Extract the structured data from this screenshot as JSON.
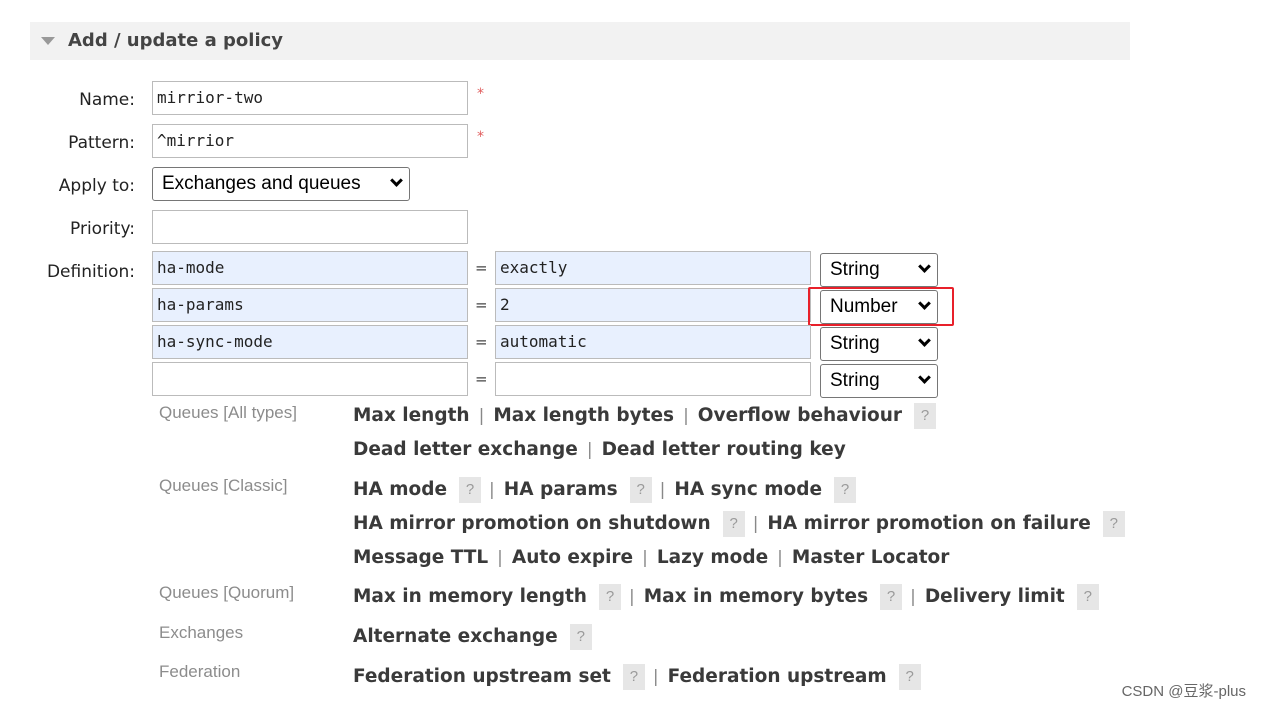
{
  "section": {
    "title": "Add / update a policy"
  },
  "form": {
    "name_label": "Name:",
    "name_value": "mirrior-two",
    "pattern_label": "Pattern:",
    "pattern_value": "^mirrior",
    "required_mark": "*",
    "apply_to_label": "Apply to:",
    "apply_to_value": "Exchanges and queues",
    "priority_label": "Priority:",
    "priority_value": "",
    "definition_label": "Definition:"
  },
  "definitions": [
    {
      "key": "ha-mode",
      "eq": "=",
      "value": "exactly",
      "type": "String"
    },
    {
      "key": "ha-params",
      "eq": "=",
      "value": "2",
      "type": "Number"
    },
    {
      "key": "ha-sync-mode",
      "eq": "=",
      "value": "automatic",
      "type": "String"
    },
    {
      "key": "",
      "eq": "=",
      "value": "",
      "type": "String"
    }
  ],
  "help_mark": "?",
  "separator": "|",
  "categories": {
    "queues_all": "Queues [All types]",
    "queues_classic": "Queues [Classic]",
    "queues_quorum": "Queues [Quorum]",
    "exchanges": "Exchanges",
    "federation": "Federation"
  },
  "links": {
    "max_length": "Max length",
    "max_length_bytes": "Max length bytes",
    "overflow_behaviour": "Overflow behaviour",
    "dead_letter_exchange": "Dead letter exchange",
    "dead_letter_routing_key": "Dead letter routing key",
    "ha_mode": "HA mode",
    "ha_params": "HA params",
    "ha_sync_mode": "HA sync mode",
    "ha_promo_shutdown": "HA mirror promotion on shutdown",
    "ha_promo_failure": "HA mirror promotion on failure",
    "message_ttl": "Message TTL",
    "auto_expire": "Auto expire",
    "lazy_mode": "Lazy mode",
    "master_locator": "Master Locator",
    "max_in_memory_length": "Max in memory length",
    "max_in_memory_bytes": "Max in memory bytes",
    "delivery_limit": "Delivery limit",
    "alternate_exchange": "Alternate exchange",
    "federation_upstream_set": "Federation upstream set",
    "federation_upstream": "Federation upstream"
  },
  "watermark": "CSDN @豆浆-plus",
  "colors": {
    "highlight": "#e8202a",
    "field_autofill": "#e8f0fe"
  }
}
